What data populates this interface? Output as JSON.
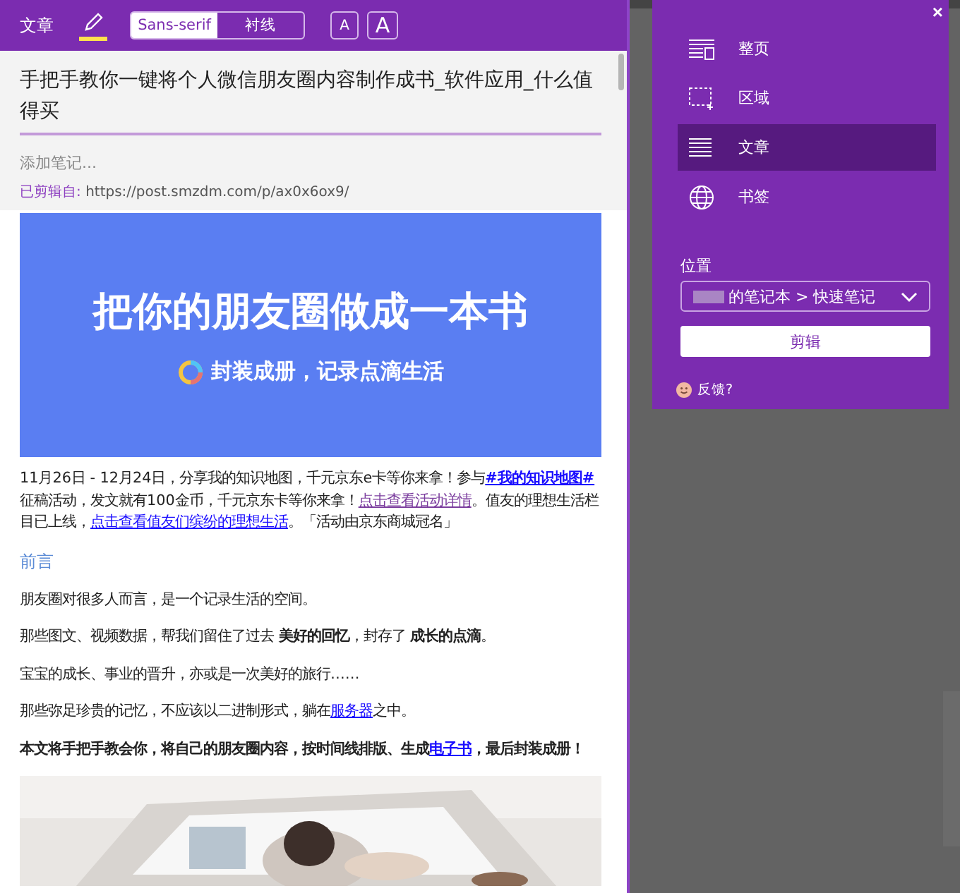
{
  "toolbar": {
    "mode": "文章",
    "highlighter_on": true,
    "fonts": [
      {
        "label": "Sans-serif",
        "selected": true
      },
      {
        "label": "衬线",
        "selected": false
      }
    ],
    "size_buttons": [
      {
        "label": "A",
        "kind": "small"
      },
      {
        "label": "A",
        "kind": "large"
      }
    ]
  },
  "clip": {
    "title": "手把手教你一键将个人微信朋友圈内容制作成书_软件应用_什么值得买",
    "note_placeholder": "添加笔记...",
    "source_label": "已剪辑自:",
    "source_url": "https://post.smzdm.com/p/ax0x6ox9/"
  },
  "article": {
    "banner": {
      "headline": "把你的朋友圈做成一本书",
      "tagline": "封装成册，记录点滴生活"
    },
    "blocks": [
      {
        "kind": "para",
        "parts": [
          {
            "kind": "text",
            "text": "11月26日 - 12月24日，分享我的知识地图，千元京东e卡等你来拿！参与"
          },
          {
            "kind": "boldlink",
            "text": "#我的知识"
          },
          {
            "kind": "boldlink",
            "text": "地图#"
          },
          {
            "kind": "text",
            "text": "征稿活动，发文就有100金币，千元京东卡等你来拿！"
          },
          {
            "kind": "visited",
            "text": "点击查看活动详情"
          },
          {
            "kind": "text",
            "text": "。值友的理想生活栏目已上线，"
          },
          {
            "kind": "link",
            "text": "点击查看值友们缤纷的理想生活"
          },
          {
            "kind": "text",
            "text": "。「活动由京东商城冠名」"
          }
        ]
      },
      {
        "kind": "heading",
        "text": "前言"
      },
      {
        "kind": "para",
        "parts": [
          {
            "kind": "text",
            "text": "朋友圈对很多人而言，是一个记录生活的空间。"
          }
        ]
      },
      {
        "kind": "para",
        "parts": [
          {
            "kind": "text",
            "text": "那些图文、视频数据，帮我们留住了过去 "
          },
          {
            "kind": "bold",
            "text": "美好的回忆"
          },
          {
            "kind": "text",
            "text": "，封存了 "
          },
          {
            "kind": "bold",
            "text": "成长的点滴"
          },
          {
            "kind": "text",
            "text": "。"
          }
        ]
      },
      {
        "kind": "para",
        "parts": [
          {
            "kind": "text",
            "text": "宝宝的成长、事业的晋升，亦或是一次美好的旅行……"
          }
        ]
      },
      {
        "kind": "para",
        "parts": [
          {
            "kind": "text",
            "text": "那些弥足珍贵的记忆，不应该以二进制形式，躺在"
          },
          {
            "kind": "link",
            "text": "服务器"
          },
          {
            "kind": "text",
            "text": "之中。"
          }
        ]
      },
      {
        "kind": "boldpara",
        "parts": [
          {
            "kind": "text",
            "text": "本文将手把手教会你，将自己的朋友圈内容，按时间线排版、生成"
          },
          {
            "kind": "link",
            "text": "电子书"
          },
          {
            "kind": "text",
            "text": "，最后封装成册！"
          }
        ]
      }
    ]
  },
  "panel": {
    "close": "×",
    "modes": [
      {
        "label": "整页",
        "kind": "fullpage",
        "selected": false
      },
      {
        "label": "区域",
        "kind": "region",
        "selected": false
      },
      {
        "label": "文章",
        "kind": "article",
        "selected": true
      },
      {
        "label": "书签",
        "kind": "bookmark",
        "selected": false
      }
    ],
    "location_label": "位置",
    "location_value": "的笔记本 > 快速笔记",
    "clip_button": "剪辑",
    "feedback": "反馈?"
  }
}
